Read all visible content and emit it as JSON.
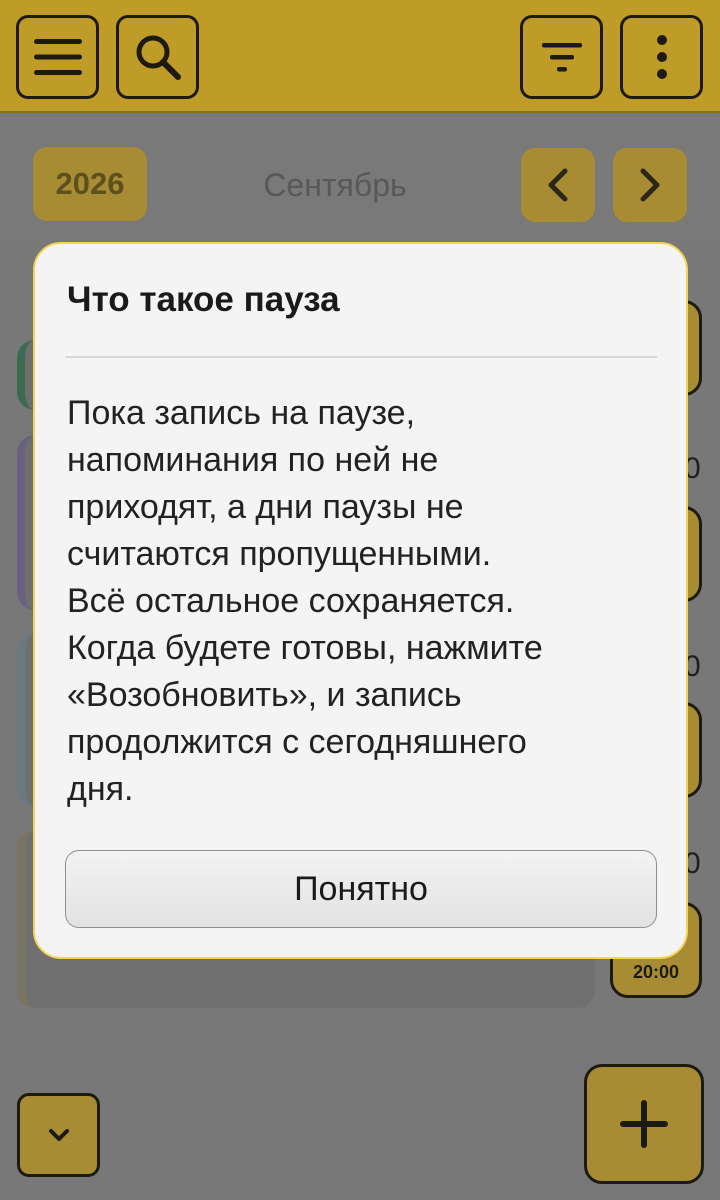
{
  "appbar": {
    "icons": [
      "menu-icon",
      "search-icon",
      "filter-icon",
      "more-vert-icon"
    ]
  },
  "month_nav": {
    "year": "2026",
    "month": "Сентябрь",
    "prev_icon": "chevron-left-icon",
    "next_icon": "chevron-right-icon"
  },
  "background_content": {
    "time_chip_label": "20:00",
    "peek_digit": "0"
  },
  "fab": {
    "collapse_icon": "chevron-down-icon",
    "add_icon": "plus-icon"
  },
  "dialog": {
    "title": "Что такое пауза",
    "body": "Пока запись на паузе,\nнапоминания по ней не\nприходят, а дни паузы не\nсчитаются пропущенными.\nВсё остальное сохраняется.\nКогда будете готовы, нажмите\n«Возобновить», и запись\nпродолжится с сегодняшнего\nдня.",
    "ok_button": "Понятно"
  },
  "colors": {
    "accent": "#f2c94c",
    "accent_dimmed": "#bf9b28",
    "scrim": "#787878",
    "dialog_bg": "#f4f4f4",
    "dialog_border": "#f2d553"
  }
}
